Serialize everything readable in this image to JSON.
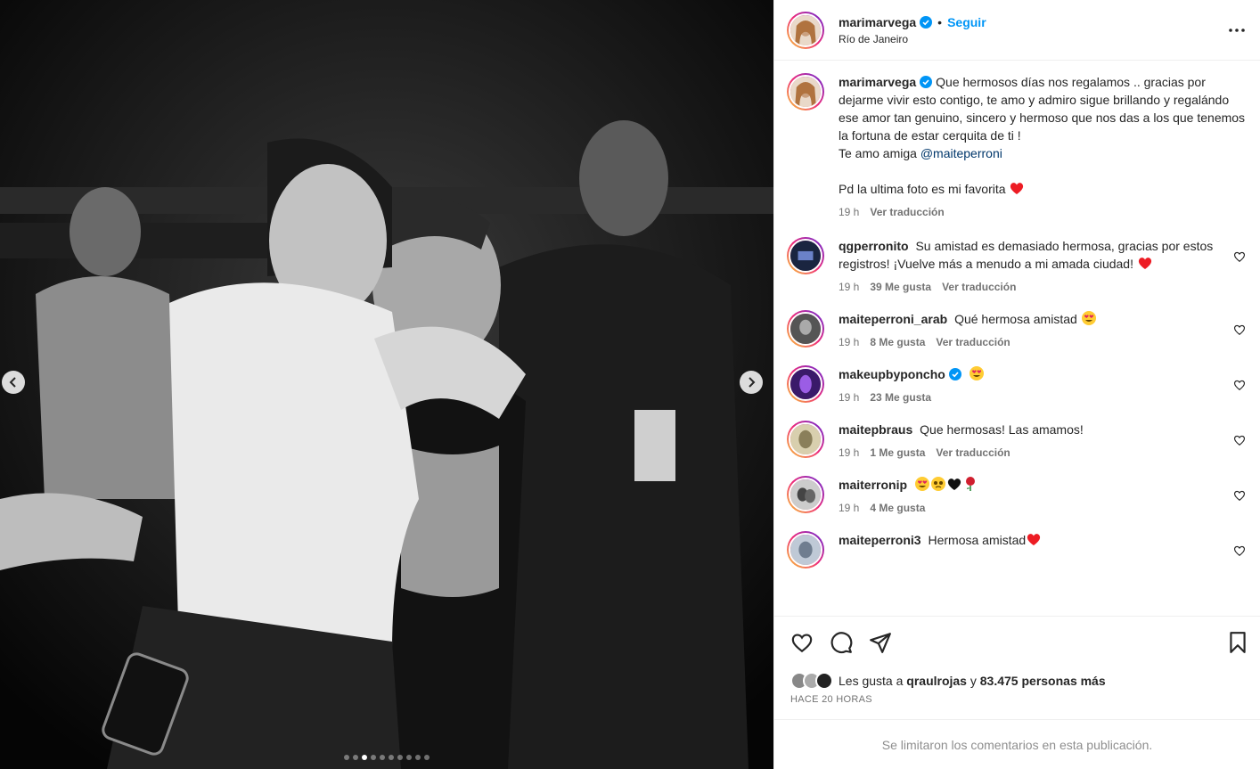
{
  "header": {
    "username": "marimarvega",
    "separator": "•",
    "follow_label": "Seguir",
    "location": "Río de Janeiro"
  },
  "caption": {
    "username": "marimarvega",
    "text": "Que hermosos días nos regalamos .. gracias por dejarme vivir esto contigo, te amo y admiro sigue brillando y regalándo ese amor tan genuino, sincero y hermoso que nos das a los que tenemos la fortuna de estar cerquita de ti !",
    "line2": "Te amo amiga",
    "mention": "@maiteperroni",
    "line3": "Pd la ultima foto es mi favorita",
    "time": "19 h",
    "translate": "Ver traducción"
  },
  "comments": [
    {
      "username": "qgperronito",
      "text": "Su amistad es demasiado hermosa, gracias por estos registros! ¡Vuelve más a menudo a mi amada ciudad!",
      "time": "19 h",
      "likes": "39 Me gusta",
      "translate": "Ver traducción"
    },
    {
      "username": "maiteperroni_arab",
      "text": "Qué hermosa amistad",
      "time": "19 h",
      "likes": "8 Me gusta",
      "translate": "Ver traducción"
    },
    {
      "username": "makeupbyponcho",
      "text": "",
      "time": "19 h",
      "likes": "23 Me gusta",
      "translate": ""
    },
    {
      "username": "maitepbraus",
      "text": "Que hermosas! Las amamos!",
      "time": "19 h",
      "likes": "1 Me gusta",
      "translate": "Ver traducción"
    },
    {
      "username": "maiterronip",
      "text": "",
      "time": "19 h",
      "likes": "4 Me gusta",
      "translate": ""
    },
    {
      "username": "maiteperroni3",
      "text": "Hermosa amistad",
      "time": "",
      "likes": "",
      "translate": ""
    }
  ],
  "likes": {
    "prefix": "Les gusta a",
    "user": "qraulrojas",
    "middle": "y",
    "count": "83.475 personas más"
  },
  "timestamp": "HACE 20 HORAS",
  "comments_limited": "Se limitaron los comentarios en esta publicación.",
  "carousel": {
    "count": 10,
    "active": 3
  },
  "colors": {
    "accent": "#0095f6",
    "verified": "#0095f6",
    "heart": "#ed4956"
  }
}
